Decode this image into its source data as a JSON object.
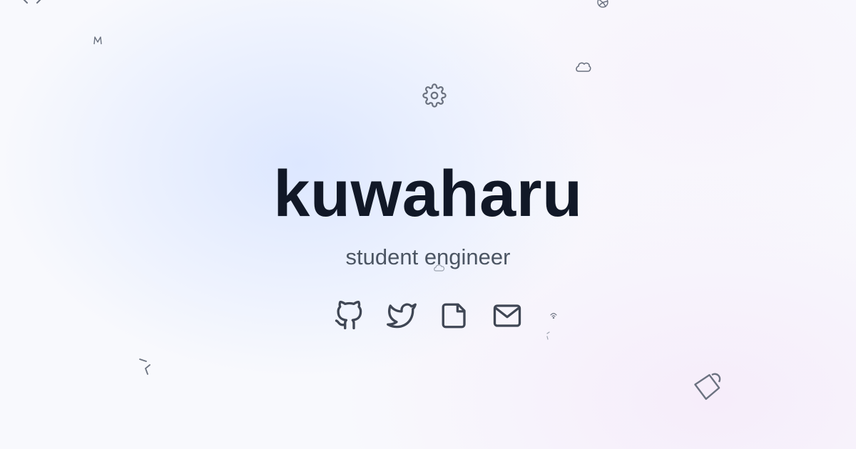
{
  "profile": {
    "name": "kuwaharu",
    "tagline": "student engineer"
  },
  "social_links": [
    {
      "icon": "github-icon"
    },
    {
      "icon": "twitter-icon"
    },
    {
      "icon": "note-icon"
    },
    {
      "icon": "mail-icon"
    }
  ],
  "decorations": [
    "code-brackets-icon",
    "m-glyph-icon",
    "gear-icon",
    "cloud-icon",
    "dribbble-ball-icon",
    "wifi-icon",
    "tag-icon",
    "chevron-left-icon"
  ],
  "colors": {
    "title": "#111827",
    "subtitle": "#4b5563",
    "icon": "#3f4654",
    "background": "#f8f9fd",
    "glow_blue": "#dbe6ff",
    "glow_pink": "#f6ecfa"
  }
}
